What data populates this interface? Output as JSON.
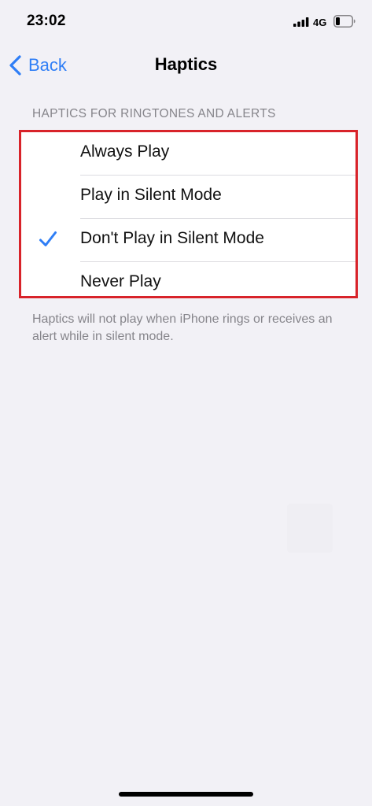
{
  "status_bar": {
    "time": "23:02",
    "network": "4G",
    "signal_icon": "cellular-signal-icon",
    "battery_icon": "battery-icon"
  },
  "nav": {
    "back_label": "Back",
    "back_icon": "chevron-left-icon",
    "title": "Haptics"
  },
  "section": {
    "header": "HAPTICS FOR RINGTONES AND ALERTS",
    "options": [
      {
        "label": "Always Play",
        "selected": false
      },
      {
        "label": "Play in Silent Mode",
        "selected": false
      },
      {
        "label": "Don't Play in Silent Mode",
        "selected": true
      },
      {
        "label": "Never Play",
        "selected": false
      }
    ],
    "footer": "Haptics will not play when iPhone rings or receives an alert while in silent mode."
  },
  "colors": {
    "accent": "#2f7ef6",
    "highlight_border": "#d8232a",
    "background": "#f2f1f6",
    "secondary_text": "#86858b"
  }
}
